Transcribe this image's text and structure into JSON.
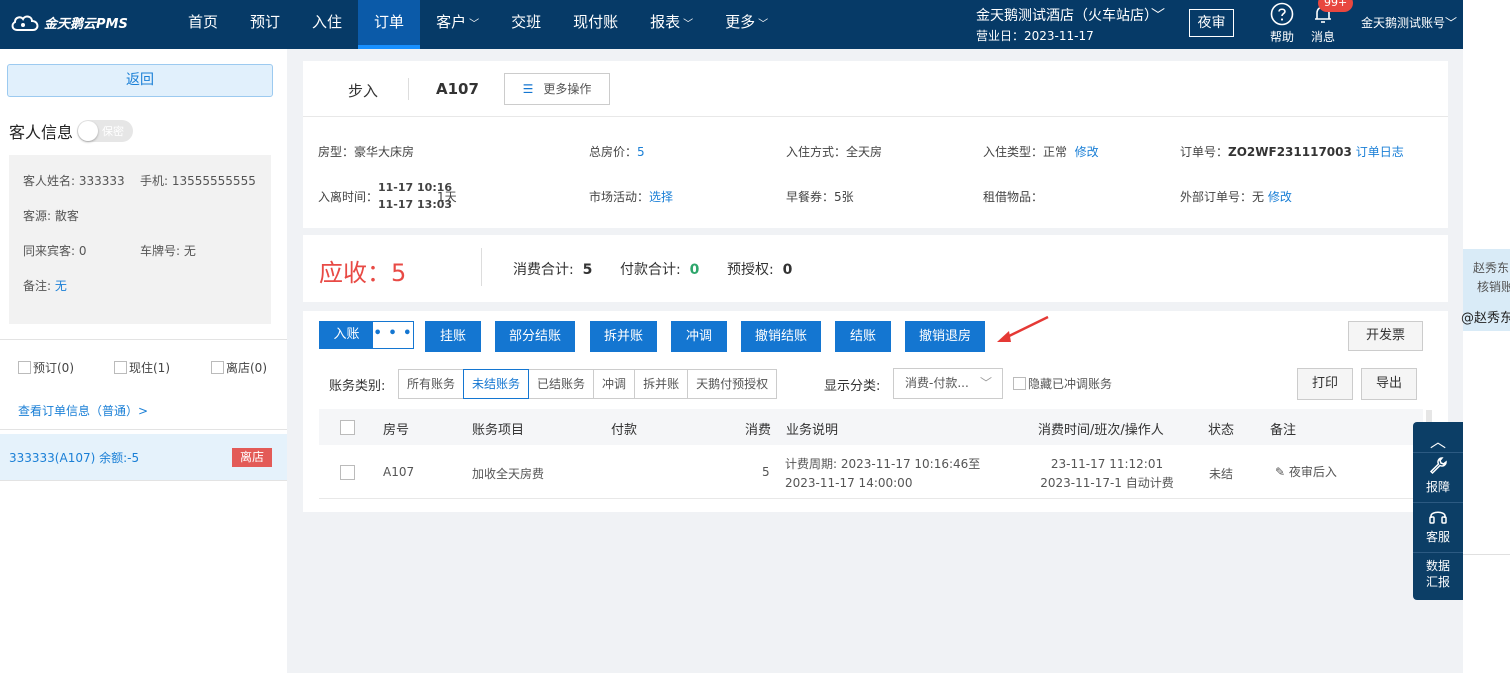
{
  "header": {
    "logo_text": "金天鹅云PMS",
    "nav": [
      {
        "label": "首页",
        "caret": ""
      },
      {
        "label": "预订",
        "caret": ""
      },
      {
        "label": "入住",
        "caret": ""
      },
      {
        "label": "订单",
        "caret": "",
        "active": true
      },
      {
        "label": "客户",
        "caret": "﹀"
      },
      {
        "label": "交班",
        "caret": ""
      },
      {
        "label": "现付账",
        "caret": ""
      },
      {
        "label": "报表",
        "caret": "﹀"
      },
      {
        "label": "更多",
        "caret": "﹀"
      }
    ],
    "hotel_name": "金天鹅测试酒店（火车站店）﹀",
    "business_date": "营业日：2023-11-17",
    "night_audit": "夜审",
    "help": "帮助",
    "messages": "消息",
    "message_badge": "99+",
    "account": "金天鹅测试账号﹀"
  },
  "left": {
    "back": "返回",
    "guest_info_title": "客人信息",
    "privacy_toggle": "保密",
    "guest": {
      "name": "客人姓名: 333333",
      "phone": "手机: 13555555555",
      "source": "客源: 散客",
      "companions": "同来宾客: 0",
      "plate": "车牌号: 无",
      "remark_label": "备注: ",
      "remark_value": "无"
    },
    "status_filters": [
      "预订(0)",
      "现住(1)",
      "离店(0)"
    ],
    "view_order_link": "查看订单信息（普通）>",
    "room_entry": "333333(A107)   余额:-5",
    "room_tag": "离店"
  },
  "order": {
    "walk_in": "步入",
    "room_no": "A107",
    "more_ops": "更多操作",
    "room_type": "房型：豪华大床房",
    "total_price_label": "总房价：",
    "total_price": "5",
    "checkin_mode": "入住方式：全天房",
    "checkin_type": "入住类型：正常",
    "modify": "修改",
    "order_no_label": "订单号：",
    "order_no": "ZO2WF231117003",
    "order_log": "订单日志",
    "stay_time_label": "入离时间：",
    "stay_in": "11-17 10:16",
    "stay_out": "11-17 13:03",
    "stay_days": "1天",
    "market_label": "市场活动：",
    "market_value": "选择",
    "breakfast": "早餐券：5张",
    "rentals": "租借物品：",
    "ext_order_label": "外部订单号：无",
    "ext_modify": "修改"
  },
  "summary": {
    "due_label": "应收：",
    "due_value": "5",
    "consume_label": "消费合计:",
    "consume_value": "5",
    "payment_label": "付款合计:",
    "payment_value": "0",
    "preauth_label": "预授权:",
    "preauth_value": "0"
  },
  "actions": {
    "post": "入账",
    "post_more": "• • •",
    "buttons": [
      "挂账",
      "部分结账",
      "拆并账",
      "冲调",
      "撤销结账",
      "结账",
      "撤销退房"
    ],
    "invoice": "开发票",
    "print": "打印",
    "export": "导出"
  },
  "filters": {
    "category_label": "账务类别:",
    "categories": [
      "所有账务",
      "未结账务",
      "已结账务",
      "冲调",
      "拆并账",
      "天鹅付预授权"
    ],
    "active_category": "未结账务",
    "display_label": "显示分类:",
    "display_value": "消费-付款...",
    "hide_reversed": "隐藏已冲调账务"
  },
  "table": {
    "columns": [
      "房号",
      "账务项目",
      "付款",
      "消费",
      "业务说明",
      "消费时间/班次/操作人",
      "状态",
      "备注"
    ],
    "rows": [
      {
        "room": "A107",
        "item": "加收全天房费",
        "payment": "",
        "consume": "5",
        "desc_line1": "计费周期: 2023-11-17 10:16:46至",
        "desc_line2": "2023-11-17 14:00:00",
        "time_line1": "23-11-17 11:12:01",
        "time_line2": "2023-11-17-1 自动计费",
        "status": "未结",
        "remark": "夜审后入"
      }
    ]
  },
  "side_tools": {
    "repair": "报障",
    "service": "客服",
    "data_report_1": "数据",
    "data_report_2": "汇报"
  },
  "outside": {
    "name1": "赵秀东",
    "name2": "核销账",
    "mention": "@赵秀东"
  }
}
